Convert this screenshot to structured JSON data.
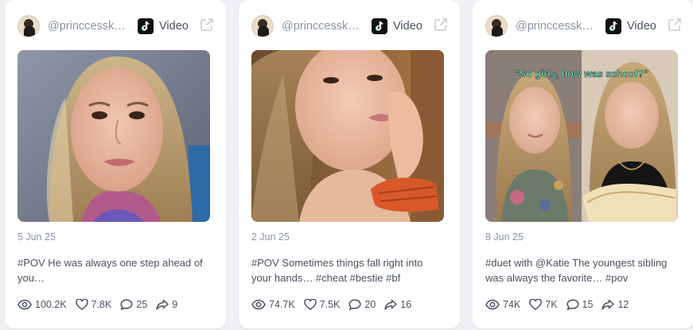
{
  "colors": {
    "muted_text": "#8a93a3",
    "body_text": "#4a5160",
    "card_bg": "#ffffff",
    "page_bg": "#eef0f4"
  },
  "posts": [
    {
      "username": "@princcesskati…",
      "platform_icon": "tiktok-icon",
      "platform_label": "Video",
      "date": "5 Jun 25",
      "caption": "#POV He was always one step ahead of you…",
      "stats": {
        "views": "100.2K",
        "likes": "7.8K",
        "comments": "25",
        "shares": "9"
      }
    },
    {
      "username": "@princcesskati…",
      "platform_icon": "tiktok-icon",
      "platform_label": "Video",
      "date": "2 Jun 25",
      "caption": "#POV Sometimes things fall right into your hands… #cheat #bestie #bf",
      "stats": {
        "views": "74.7K",
        "likes": "7.5K",
        "comments": "20",
        "shares": "16"
      }
    },
    {
      "username": "@princcesskati…",
      "platform_icon": "tiktok-icon",
      "platform_label": "Video",
      "date": "8 Jun 25",
      "caption": "#duet with @Katie The youngest sibling was always the favorite… #pov",
      "thumb_overlay_text": "\"So girls, how was school?\"",
      "stats": {
        "views": "74K",
        "likes": "7K",
        "comments": "15",
        "shares": "12"
      }
    }
  ]
}
